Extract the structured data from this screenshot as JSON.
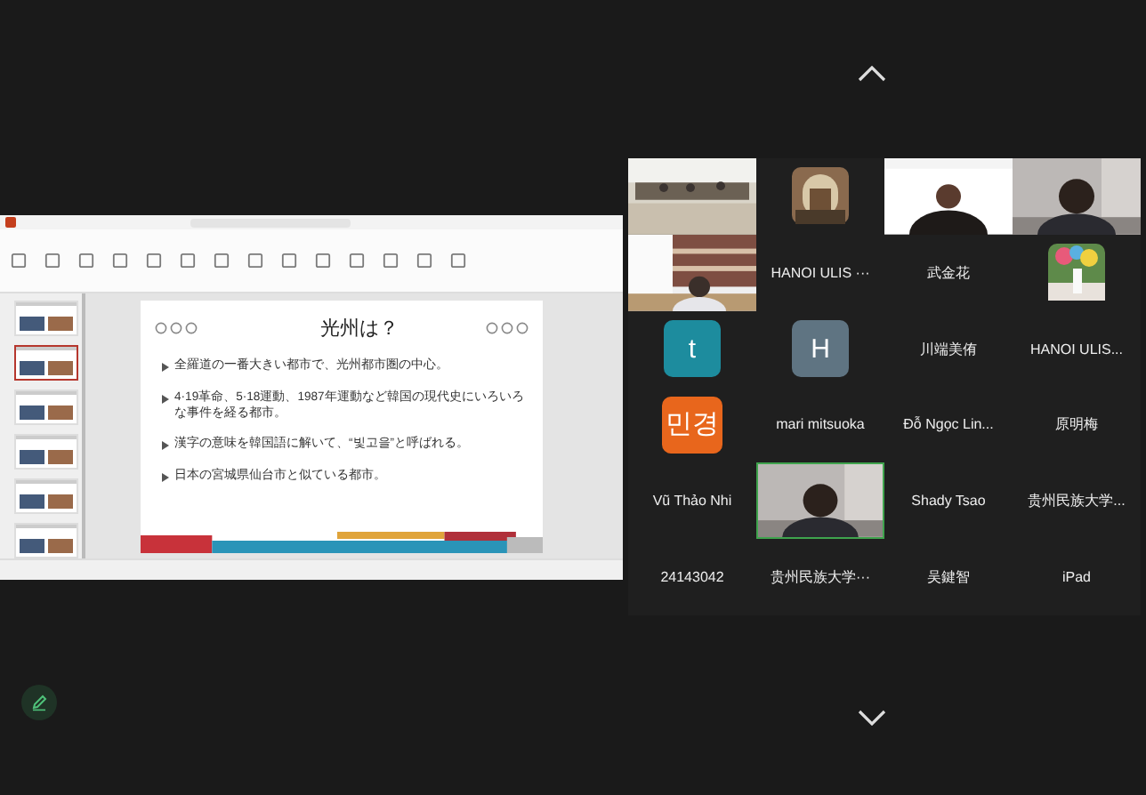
{
  "presentation": {
    "thumbnails": [
      {
        "selected": false
      },
      {
        "selected": true
      },
      {
        "selected": false
      },
      {
        "selected": false
      },
      {
        "selected": false
      },
      {
        "selected": false
      }
    ],
    "slide": {
      "title": "光州は？",
      "bullets": [
        "全羅道の一番大きい都市で、光州都市圏の中心。",
        "4·19革命、5·18運動、1987年運動など韓国の現代史にいろいろな事件を経る都市。",
        "漢字の意味を韓国語に解いて、“빛고을”と呼ばれる。",
        "日本の宮城県仙台市と似ている都市。"
      ]
    }
  },
  "participants": [
    {
      "kind": "video",
      "speaking": false
    },
    {
      "kind": "avatar_picture",
      "speaking": false
    },
    {
      "kind": "video",
      "speaking": false
    },
    {
      "kind": "video",
      "speaking": false
    },
    {
      "kind": "video",
      "speaking": false
    },
    {
      "kind": "name",
      "name": "HANOI ULIS ···",
      "speaking": false
    },
    {
      "kind": "name",
      "name": "武金花",
      "speaking": false
    },
    {
      "kind": "avatar_picture",
      "speaking": false
    },
    {
      "kind": "letter",
      "letter": "t",
      "color": "#1d8c9e",
      "speaking": false
    },
    {
      "kind": "letter",
      "letter": "H",
      "color": "#5f7482",
      "speaking": false
    },
    {
      "kind": "name",
      "name": "川端美侑",
      "speaking": false
    },
    {
      "kind": "name",
      "name": "HANOI ULIS...",
      "speaking": false
    },
    {
      "kind": "letter",
      "letter": "민경",
      "color": "#e8661c",
      "speaking": false
    },
    {
      "kind": "name",
      "name": "mari mitsuoka",
      "speaking": false
    },
    {
      "kind": "name",
      "name": "Đỗ Ngọc Lin...",
      "speaking": false
    },
    {
      "kind": "name",
      "name": "原明梅",
      "speaking": false
    },
    {
      "kind": "name",
      "name": "Vũ Thảo Nhi",
      "speaking": false
    },
    {
      "kind": "video",
      "speaking": true
    },
    {
      "kind": "name",
      "name": "Shady Tsao",
      "speaking": false
    },
    {
      "kind": "name",
      "name": "贵州民族大学...",
      "speaking": false
    },
    {
      "kind": "name",
      "name": "24143042",
      "speaking": false
    },
    {
      "kind": "name",
      "name": "贵州民族大学···",
      "speaking": false
    },
    {
      "kind": "name",
      "name": "吴鍵智",
      "speaking": false
    },
    {
      "kind": "name",
      "name": "iPad",
      "speaking": false
    }
  ]
}
